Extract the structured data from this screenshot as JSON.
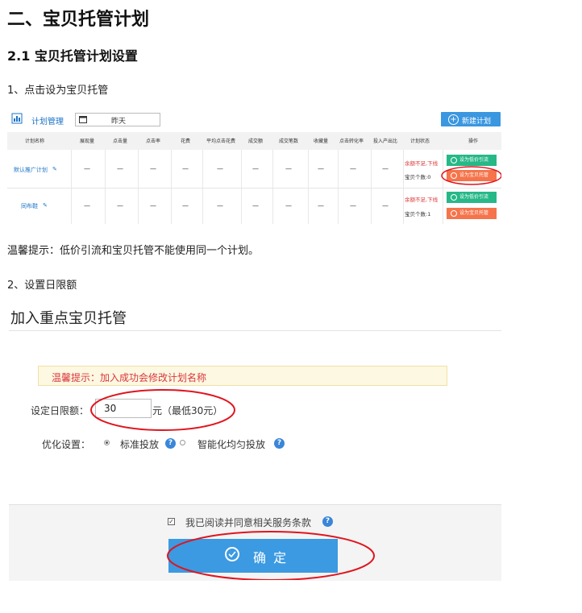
{
  "doc": {
    "h1": "二、宝贝托管计划",
    "h2": "2.1 宝贝托管计划设置",
    "step1": "1、点击设为宝贝托管",
    "tip1": "温馨提示：低价引流和宝贝托管不能使用同一个计划。",
    "step2": "2、设置日限额"
  },
  "plan_manager": {
    "title": "计划管理",
    "date_value": "昨天",
    "new_plan_button": "新建计划",
    "columns": [
      "计划名称",
      "展现量",
      "点击量",
      "点击率",
      "花费",
      "平均点击花费",
      "成交额",
      "成交笔数",
      "收藏量",
      "点击转化率",
      "投入产出比",
      "计划状态",
      "操作"
    ],
    "rows": [
      {
        "name": "默认推广计划",
        "cells": [
          "—",
          "—",
          "—",
          "—",
          "—",
          "—",
          "—",
          "—",
          "—",
          "—"
        ],
        "status_line1": "余额不足,下线",
        "status_line2": "宝贝个数:0",
        "btn1": "设为低价引流",
        "btn2": "设为宝贝托管"
      },
      {
        "name": "同布鞋",
        "cells": [
          "—",
          "—",
          "—",
          "—",
          "—",
          "—",
          "—",
          "—",
          "—",
          "—"
        ],
        "status_line1": "余额不足,下线",
        "status_line2": "宝贝个数:1",
        "btn1": "设为低价引流",
        "btn2": "设为宝贝托管"
      }
    ]
  },
  "dialog": {
    "title": "加入重点宝贝托管",
    "tip": "温馨提示：加入成功会修改计划名称",
    "budget_label": "设定日限额：",
    "budget_value": "30",
    "budget_unit": "元（最低30元）",
    "optimize_label": "优化设置：",
    "option_standard": "标准投放",
    "option_smart": "智能化均匀投放",
    "agree_text": "我已阅读并同意相关服务条款",
    "confirm_button": "确 定",
    "help_mark": "?"
  },
  "colors": {
    "accent_blue": "#3b9ae1",
    "green_button": "#27b888",
    "orange_button": "#f5744b",
    "highlight_red": "#e0141e",
    "tip_red": "#d9363e"
  }
}
